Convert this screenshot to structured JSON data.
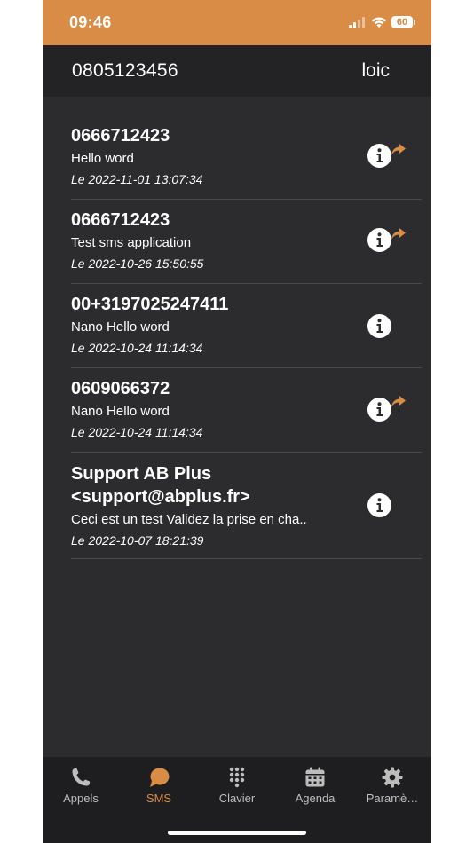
{
  "status_bar": {
    "time": "09:46",
    "battery": "60",
    "color": "#d88c45"
  },
  "header": {
    "line_number": "0805123456",
    "user": "loic"
  },
  "sms": [
    {
      "sender": "0666712423",
      "body": "Hello word",
      "date": "Le 2022-11-01 13:07:34",
      "forwarded": true
    },
    {
      "sender": "0666712423",
      "body": "Test sms application",
      "date": "Le 2022-10-26 15:50:55",
      "forwarded": true
    },
    {
      "sender": "00+3197025247411",
      "body": "Nano Hello word",
      "date": "Le 2022-10-24 11:14:34",
      "forwarded": false
    },
    {
      "sender": "0609066372",
      "body": "Nano Hello word",
      "date": "Le 2022-10-24 11:14:34",
      "forwarded": true
    },
    {
      "sender": "Support AB Plus <support@abplus.fr>",
      "body": "Ceci est un test Validez la prise en cha..",
      "date": "Le 2022-10-07 18:21:39",
      "forwarded": false
    }
  ],
  "tabs": [
    {
      "label": "Appels",
      "icon": "phone-icon",
      "active": false
    },
    {
      "label": "SMS",
      "icon": "chat-bubble-icon",
      "active": true
    },
    {
      "label": "Clavier",
      "icon": "keypad-icon",
      "active": false
    },
    {
      "label": "Agenda",
      "icon": "calendar-icon",
      "active": false
    },
    {
      "label": "Paramè…",
      "icon": "gear-icon",
      "active": false
    }
  ],
  "colors": {
    "accent": "#d88c45",
    "background": "#2c2c2e",
    "header": "#232325",
    "tab_bar": "#1e1e20"
  }
}
